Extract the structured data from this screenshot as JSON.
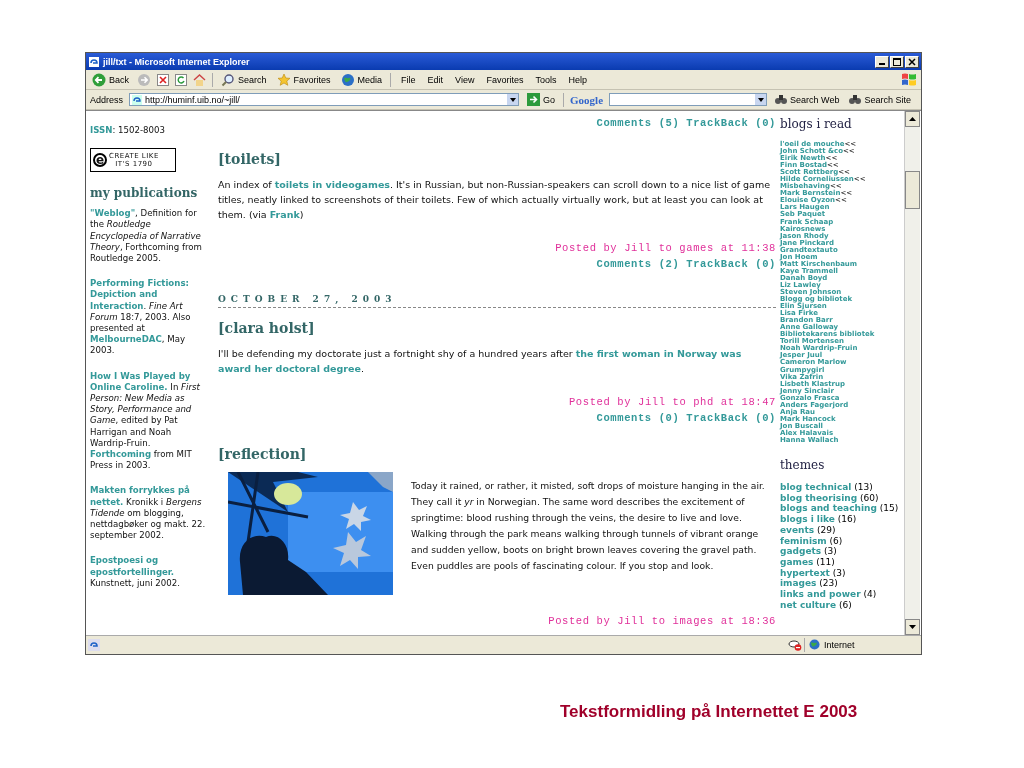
{
  "window": {
    "title": "jill/txt - Microsoft Internet Explorer"
  },
  "toolbar": {
    "buttons": [
      {
        "label": "Back",
        "kind": "back"
      },
      {
        "label": "Search",
        "kind": "search"
      },
      {
        "label": "Favorites",
        "kind": "favorites"
      },
      {
        "label": "Media",
        "kind": "media"
      }
    ]
  },
  "menu": [
    "File",
    "Edit",
    "View",
    "Favorites",
    "Tools",
    "Help"
  ],
  "address_bar": {
    "label": "Address",
    "url": "http://huminf.uib.no/~jill/",
    "go": "Go"
  },
  "google_bar": {
    "logo": "Google",
    "buttons": [
      "Search Web",
      "Search Site"
    ]
  },
  "left_column": {
    "issn": "**ISSN**: 1502-8003",
    "badge": {
      "letter": "e",
      "line1": "CREATE LIKE",
      "line2": "IT'S 1790"
    },
    "heading": "my publications",
    "publications": [
      "**\"Weblog\"**, Definition for the *Routledge Encyclopedia of Narrative Theory*, Forthcoming from Routledge 2005.",
      "**Performing Fictions: Depiction and Interaction**. *Fine Art Forum* 18:7, 2003. Also presented at **MelbourneDAC**, May 2003.",
      "**How I Was Played by Online Caroline.** In *First Person: New Media as Story, Performance and Game*, edited by Pat Harrigan and Noah Wardrip-Fruin. **Forthcoming** from MIT Press in 2003.",
      "**Makten forrykkes på nettet.** Kronikk i *Bergens Tidende* om blogging, nettdagbøker og makt. 22. september 2002.",
      "**Epostpoesi og epostfortellinger.** Kunstnett, juni 2002."
    ]
  },
  "main": {
    "top_comments": "Comments (5) TrackBack (0)",
    "posts": [
      {
        "title": "[toilets]",
        "body": "An index of **toilets in videogames**. It's in Russian, but non-Russian-speakers can scroll down to a nice list of game titles, neatly linked to screenshots of their toilets. Few of which actually virtually work, but at least you can look at them. (via **Frank**)",
        "posted": "Posted by Jill to games at 11:38",
        "comments": "Comments (2) TrackBack (0)"
      },
      {
        "date": "OCTOBER 27, 2003",
        "title": "[clara holst]",
        "body": "I'll be defending my doctorate just a fortnight shy of a hundred years after **the first woman in Norway was award her doctoral degree**.",
        "posted": "Posted by Jill to phd at 18:47",
        "comments": "Comments (0) TrackBack (0)"
      },
      {
        "title": "[reflection]",
        "body": "Today it rained, or rather, it misted, soft drops of moisture hanging in the air. They call it *yr* in Norwegian. The same word describes the excitement of springtime: blood rushing through the veins, the desire to live and love. Walking through the park means walking through tunnels of vibrant orange and sudden yellow, boots on bright brown leaves covering the gravel path. Even puddles are pools of fascinating colour. If you stop and look.",
        "posted": "Posted by Jill to images at 18:36"
      }
    ]
  },
  "right_column": {
    "blogs_heading": "blogs i read",
    "blogs": [
      {
        "name": "l'oeil de mouche",
        "mark": "<<"
      },
      {
        "name": "John Schott &co",
        "mark": "<<"
      },
      {
        "name": "Eirik Newth",
        "mark": "<<"
      },
      {
        "name": "Finn Bostad",
        "mark": "<<"
      },
      {
        "name": "Scott Rettberg",
        "mark": "<<"
      },
      {
        "name": "Hilde Corneliussen",
        "mark": "<<"
      },
      {
        "name": "Misbehaving",
        "mark": "<<"
      },
      {
        "name": "Mark Bernstein",
        "mark": "<<"
      },
      {
        "name": "Elouise Oyzon",
        "mark": "<<"
      },
      {
        "name": "Lars Haugen"
      },
      {
        "name": "Seb Paquet"
      },
      {
        "name": "Frank Schaap"
      },
      {
        "name": "Kairosnews"
      },
      {
        "name": "Jason Rhody"
      },
      {
        "name": "Jane Pinckard"
      },
      {
        "name": "Grandtextauto"
      },
      {
        "name": "Jon Hoem"
      },
      {
        "name": "Matt Kirschenbaum"
      },
      {
        "name": "Kaye Trammell"
      },
      {
        "name": "Danah Boyd"
      },
      {
        "name": "Liz Lawley"
      },
      {
        "name": "Steven Johnson"
      },
      {
        "name": "Blogg og bibliotek"
      },
      {
        "name": "Elin Sjursen"
      },
      {
        "name": "Lisa Firke"
      },
      {
        "name": "Brandon Barr"
      },
      {
        "name": "Anne Galloway"
      },
      {
        "name": "Bibliotekarens bibliotek"
      },
      {
        "name": "Torill Mortensen"
      },
      {
        "name": "Noah Wardrip-Fruin"
      },
      {
        "name": "Jesper Juul"
      },
      {
        "name": "Cameron Marlow"
      },
      {
        "name": "Grumpygirl"
      },
      {
        "name": "Vika Zafrin"
      },
      {
        "name": "Lisbeth Klastrup"
      },
      {
        "name": "Jenny Sinclair"
      },
      {
        "name": "Gonzalo Frasca"
      },
      {
        "name": "Anders Fagerjord"
      },
      {
        "name": "Anja Rau"
      },
      {
        "name": "Mark Hancock"
      },
      {
        "name": "Jon Buscall"
      },
      {
        "name": "Alex Halavais"
      },
      {
        "name": "Hanna Wallach"
      }
    ],
    "themes_heading": "themes",
    "themes": [
      {
        "name": "blog technical",
        "count": "(13)"
      },
      {
        "name": "blog theorising",
        "count": "(60)"
      },
      {
        "name": "blogs and teaching",
        "count": "(15)"
      },
      {
        "name": "blogs i like",
        "count": "(16)"
      },
      {
        "name": "events",
        "count": "(29)"
      },
      {
        "name": "feminism",
        "count": "(6)"
      },
      {
        "name": "gadgets",
        "count": "(3)"
      },
      {
        "name": "games",
        "count": "(11)"
      },
      {
        "name": "hypertext",
        "count": "(3)"
      },
      {
        "name": "images",
        "count": "(23)"
      },
      {
        "name": "links and power",
        "count": "(4)"
      },
      {
        "name": "net culture",
        "count": "(6)"
      }
    ]
  },
  "status_bar": {
    "zone": "Internet"
  },
  "caption": "Tekstformidling på Internettet E 2003"
}
